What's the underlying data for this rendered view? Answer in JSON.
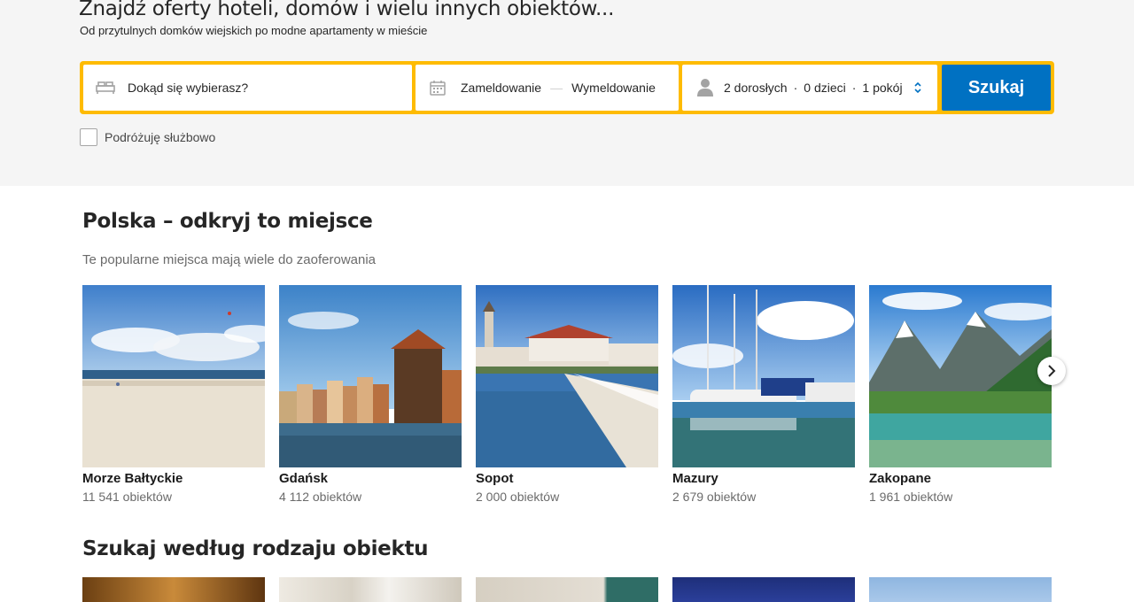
{
  "hero": {
    "title": "Znajdź oferty hoteli, domów i wielu innych obiektów...",
    "subtitle": "Od przytulnych domków wiejskich po modne apartamenty w mieście"
  },
  "search": {
    "destination_placeholder": "Dokąd się wybierasz?",
    "checkin_label": "Zameldowanie",
    "date_separator": "—",
    "checkout_label": "Wymeldowanie",
    "adults": "2 dorosłych",
    "children": "0 dzieci",
    "rooms": "1 pokój",
    "separator": "·",
    "button_label": "Szukaj",
    "accent_color": "#febb02",
    "button_color": "#0071c2"
  },
  "business_travel": {
    "label": "Podróżuję służbowo"
  },
  "explore": {
    "title": "Polska – odkryj to miejsce",
    "subtitle": "Te popularne miejsca mają wiele do zaoferowania",
    "destinations": [
      {
        "name": "Morze Bałtyckie",
        "count": "11 541 obiektów"
      },
      {
        "name": "Gdańsk",
        "count": "4 112 obiektów"
      },
      {
        "name": "Sopot",
        "count": "2 000 obiektów"
      },
      {
        "name": "Mazury",
        "count": "2 679 obiektów"
      },
      {
        "name": "Zakopane",
        "count": "1 961 obiektów"
      }
    ]
  },
  "property_types": {
    "title": "Szukaj według rodzaju obiektu"
  }
}
